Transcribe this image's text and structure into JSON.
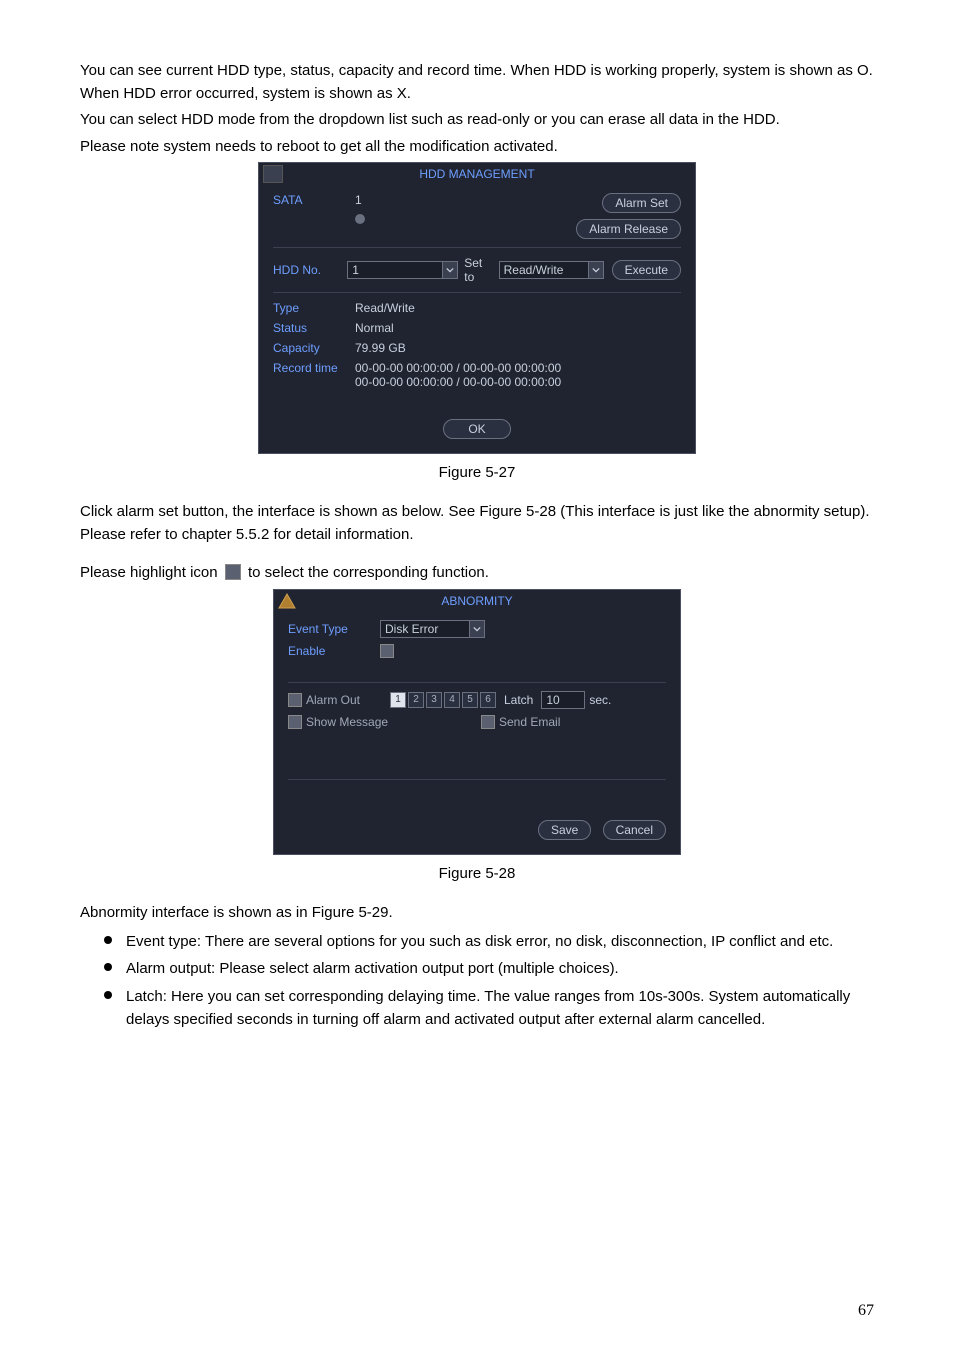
{
  "para1": "You can see current HDD type, status, capacity and record time. When HDD is working properly, system is shown as O. When HDD error occurred, system is shown as X.",
  "para2": "You can select HDD mode from the dropdown list such as read-only or you can erase all data in the HDD.",
  "para3": "Please note system needs to reboot to get all the modification activated.",
  "fig1_caption": "Figure 5-27",
  "para4": "Click alarm set button, the interface is shown as below. See Figure 5-28 (This interface is just like the abnormity setup). Please refer to chapter 5.5.2 for detail information.",
  "para5a": "Please highlight icon ",
  "para5b": " to select the corresponding function.",
  "fig2_caption": "Figure 5-28",
  "para6": "Abnormity interface is shown as in Figure 5-29.",
  "bullets": [
    "Event type: There are several options for you such as disk error, no disk, disconnection, IP conflict and etc.",
    "Alarm output: Please select alarm activation output port (multiple choices).",
    "Latch: Here you can set corresponding delaying time. The value ranges from 10s-300s. System automatically delays specified seconds in turning off alarm and activated output after external alarm cancelled."
  ],
  "page_number": "67",
  "hdd": {
    "title": "HDD MANAGEMENT",
    "sata_label": "SATA",
    "sata_value": "1",
    "alarm_set": "Alarm Set",
    "alarm_release": "Alarm Release",
    "hdd_no_label": "HDD No.",
    "hdd_no_value": "1",
    "set_to": "Set to",
    "set_to_value": "Read/Write",
    "execute": "Execute",
    "type_label": "Type",
    "type_value": "Read/Write",
    "status_label": "Status",
    "status_value": "Normal",
    "capacity_label": "Capacity",
    "capacity_value": "79.99 GB",
    "record_time_label": "Record time",
    "record_time_value_1": "00-00-00 00:00:00 / 00-00-00 00:00:00",
    "record_time_value_2": "00-00-00 00:00:00 / 00-00-00 00:00:00",
    "ok": "OK"
  },
  "ab": {
    "title": "ABNORMITY",
    "event_type_label": "Event Type",
    "event_type_value": "Disk Error",
    "enable_label": "Enable",
    "alarm_out_label": "Alarm Out",
    "digits": [
      "1",
      "2",
      "3",
      "4",
      "5",
      "6"
    ],
    "latch_label": "Latch",
    "latch_value": "10",
    "sec": "sec.",
    "show_message": "Show Message",
    "send_email": "Send Email",
    "save": "Save",
    "cancel": "Cancel"
  }
}
